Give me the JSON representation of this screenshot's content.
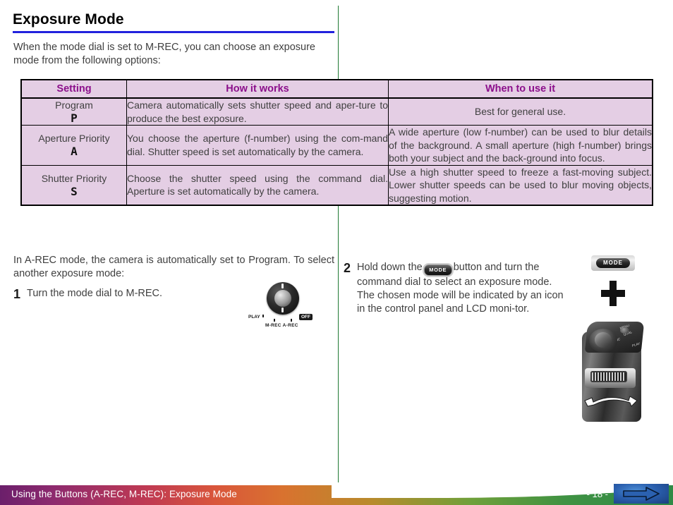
{
  "page": {
    "title": "Exposure Mode",
    "intro": "When the mode dial is set to M-REC, you can choose an exposure mode from the following options:",
    "accent_rule_color": "#2222dd",
    "divider_color": "#1f7a33"
  },
  "table": {
    "header_text_color": "#8b0f8b",
    "cell_background": "#e4cee4",
    "columns": [
      "Setting",
      "How it works",
      "When to use it"
    ],
    "rows": [
      {
        "setting": "Program",
        "symbol": "P",
        "how_it_works": "Camera automatically sets shutter speed and aper-ture to produce the best exposure.",
        "when_to_use": "Best for general use."
      },
      {
        "setting": "Aperture Priority",
        "symbol": "A",
        "how_it_works": "You choose the aperture (f-number) using the com-mand dial.  Shutter speed is set automatically by the camera.",
        "when_to_use": "A wide aperture (low f-number) can be used to blur details of the background.  A small aperture (high f-number) brings both your subject and the back-ground into focus."
      },
      {
        "setting": "Shutter Priority",
        "symbol": "S",
        "how_it_works": "Choose the shutter speed using the command dial. Aperture is set automatically by the camera.",
        "when_to_use": "Use a high shutter speed to freeze a fast-moving subject.  Lower shutter speeds can be used to blur moving objects, suggesting motion."
      }
    ]
  },
  "left_column": {
    "intro": "In A-REC mode, the camera is automatically set to Program.  To select another exposure mode:",
    "step": {
      "number": "1",
      "text": "Turn the mode dial to M-REC."
    },
    "dial_illustration": {
      "labels": {
        "play": "PLAY",
        "off": "OFF",
        "rec": "M-REC  A-REC"
      }
    }
  },
  "right_column": {
    "step": {
      "number": "2",
      "text_before_chip": "Hold down the",
      "chip_label": "MODE",
      "text_after_chip": "button and turn the command dial to select an exposure mode. The chosen mode will be indicated by an icon in the control panel and LCD moni-tor."
    },
    "mode_key_label": "MODE",
    "camera_illustration": {
      "labels": [
        "MENU",
        "QUAL",
        "FUNC",
        "PLAY"
      ]
    }
  },
  "footer": {
    "breadcrumb": "Using the Buttons (A-REC, M-REC): Exposure Mode",
    "page_number": "- 18 -",
    "next_label": "next-page-arrow",
    "next_button_color": "#2a5fae"
  }
}
